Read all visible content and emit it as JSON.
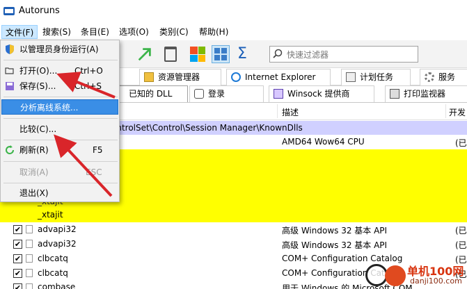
{
  "window": {
    "title": "Autoruns"
  },
  "menubar": {
    "items": [
      "文件(F)",
      "搜索(S)",
      "条目(E)",
      "选项(O)",
      "类别(C)",
      "帮助(H)"
    ]
  },
  "toolbar": {
    "filter_placeholder": "快速过滤器"
  },
  "tabs": {
    "row1": [
      "资源管理器",
      "Internet Explorer",
      "计划任务",
      "服务"
    ],
    "row2": [
      "已知的 DLL",
      "登录",
      "Winsock 提供商",
      "打印监视器"
    ]
  },
  "columns": {
    "description": "描述",
    "publisher": "开发"
  },
  "group_row": "ontrolSet\\Control\\Session Manager\\KnownDlls",
  "rows": [
    {
      "name": "",
      "description": "AMD64 Wow64 CPU",
      "publisher": "(已"
    },
    {
      "name": "_xtajit",
      "description": "",
      "publisher": ""
    },
    {
      "name": "advapi32",
      "description": "高级 Windows 32 基本 API",
      "publisher": "(已"
    },
    {
      "name": "advapi32",
      "description": "高级 Windows 32 基本 API",
      "publisher": "(已"
    },
    {
      "name": "clbcatq",
      "description": "COM+ Configuration Catalog",
      "publisher": "(已"
    },
    {
      "name": "clbcatq",
      "description": "COM+ Configuration Catalog",
      "publisher": "(已"
    },
    {
      "name": "combase",
      "description": "用于 Windows 的 Microsoft COM",
      "publisher": ""
    }
  ],
  "context_menu": {
    "run_as_admin": "以管理员身份运行(A)",
    "open": "打开(O)...",
    "open_shortcut": "Ctrl+O",
    "save": "保存(S)...",
    "save_shortcut": "Ctrl+S",
    "analyze_offline": "分析离线系统...",
    "compare": "比较(C)...",
    "refresh": "刷新(R)",
    "refresh_shortcut": "F5",
    "cancel": "取消(A)",
    "cancel_shortcut": "ESC",
    "exit": "退出(X)"
  },
  "watermark": {
    "line1": "单机100网",
    "line2": "danji100.com"
  },
  "colors": {
    "highlight": "#3a8ee6",
    "yellow_row": "#ffff00",
    "group_row": "#d0d0ff",
    "arrow": "#d9252a"
  }
}
